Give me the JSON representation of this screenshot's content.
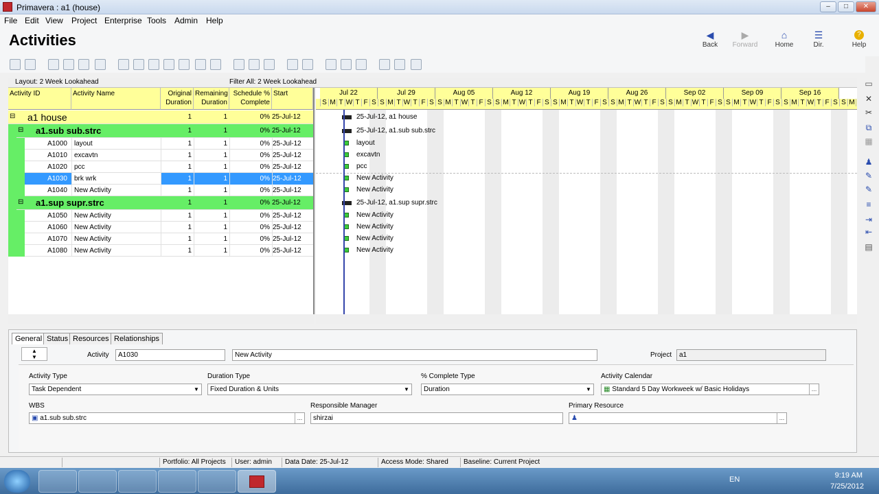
{
  "window": {
    "title": "Primavera : a1 (house)",
    "min": "–",
    "max": "□",
    "close": "✕"
  },
  "menu": [
    "File",
    "Edit",
    "View",
    "Project",
    "Enterprise",
    "Tools",
    "Admin",
    "Help"
  ],
  "header": {
    "title": "Activities",
    "nav": [
      {
        "label": "Back",
        "icon": "◀"
      },
      {
        "label": "Forward",
        "icon": "▶"
      },
      {
        "label": "Home",
        "icon": "⌂"
      },
      {
        "label": "Dir.",
        "icon": "☰"
      },
      {
        "label": "Help",
        "icon": "?"
      }
    ]
  },
  "panel": {
    "layout": "Layout: 2 Week Lookahead",
    "filter": "Filter All: 2 Week Lookahead"
  },
  "columns": {
    "id": "Activity ID",
    "name": "Activity Name",
    "orig": "Original Duration",
    "rem": "Remaining Duration",
    "pct": "Schedule % Complete",
    "start": "Start"
  },
  "rows": [
    {
      "type": "project",
      "id": "a1  house",
      "name": "",
      "orig": "1",
      "rem": "1",
      "pct": "0%",
      "start": "25-Jul-12",
      "bar": "25-Jul-12, a1  house"
    },
    {
      "type": "wbs",
      "id": "a1.sub  sub.strc",
      "name": "",
      "orig": "1",
      "rem": "1",
      "pct": "0%",
      "start": "25-Jul-12",
      "bar": "25-Jul-12, a1.sub  sub.strc"
    },
    {
      "type": "act",
      "id": "A1000",
      "name": "layout",
      "orig": "1",
      "rem": "1",
      "pct": "0%",
      "start": "25-Jul-12",
      "bar": "layout"
    },
    {
      "type": "act",
      "id": "A1010",
      "name": "excavtn",
      "orig": "1",
      "rem": "1",
      "pct": "0%",
      "start": "25-Jul-12",
      "bar": "excavtn"
    },
    {
      "type": "act",
      "id": "A1020",
      "name": "pcc",
      "orig": "1",
      "rem": "1",
      "pct": "0%",
      "start": "25-Jul-12",
      "bar": "pcc"
    },
    {
      "type": "sel",
      "id": "A1030",
      "name": "brk wrk",
      "orig": "1",
      "rem": "1",
      "pct": "0%",
      "start": "25-Jul-12",
      "bar": "New Activity"
    },
    {
      "type": "act",
      "id": "A1040",
      "name": "New Activity",
      "orig": "1",
      "rem": "1",
      "pct": "0%",
      "start": "25-Jul-12",
      "bar": "New Activity"
    },
    {
      "type": "wbs",
      "id": "a1.sup  supr.strc",
      "name": "",
      "orig": "1",
      "rem": "1",
      "pct": "0%",
      "start": "25-Jul-12",
      "bar": "25-Jul-12, a1.sup  supr.strc"
    },
    {
      "type": "act",
      "id": "A1050",
      "name": "New Activity",
      "orig": "1",
      "rem": "1",
      "pct": "0%",
      "start": "25-Jul-12",
      "bar": "New Activity"
    },
    {
      "type": "act",
      "id": "A1060",
      "name": "New Activity",
      "orig": "1",
      "rem": "1",
      "pct": "0%",
      "start": "25-Jul-12",
      "bar": "New Activity"
    },
    {
      "type": "act",
      "id": "A1070",
      "name": "New Activity",
      "orig": "1",
      "rem": "1",
      "pct": "0%",
      "start": "25-Jul-12",
      "bar": "New Activity"
    },
    {
      "type": "act",
      "id": "A1080",
      "name": "New Activity",
      "orig": "1",
      "rem": "1",
      "pct": "0%",
      "start": "25-Jul-12",
      "bar": "New Activity"
    }
  ],
  "gantt": {
    "weeks": [
      "Jul 22",
      "Jul 29",
      "Aug 05",
      "Aug 12",
      "Aug 19",
      "Aug 26",
      "Sep 02",
      "Sep 09",
      "Sep 16"
    ],
    "days": "SMTWTFS"
  },
  "details": {
    "tabs": [
      "General",
      "Status",
      "Resources",
      "Relationships"
    ],
    "activity_label": "Activity",
    "activity_id": "A1030",
    "activity_name": "New Activity",
    "project_label": "Project",
    "project": "a1",
    "activity_type_label": "Activity Type",
    "activity_type": "Task Dependent",
    "duration_type_label": "Duration Type",
    "duration_type": "Fixed Duration & Units",
    "pct_type_label": "% Complete Type",
    "pct_type": "Duration",
    "calendar_label": "Activity Calendar",
    "calendar": "Standard 5 Day Workweek w/ Basic Holidays",
    "wbs_label": "WBS",
    "wbs": "a1.sub  sub.strc",
    "manager_label": "Responsible Manager",
    "manager": "shirzai",
    "resource_label": "Primary Resource",
    "resource": ""
  },
  "status": {
    "portfolio": "Portfolio: All Projects",
    "user": "User: admin",
    "data_date": "Data Date: 25-Jul-12",
    "access": "Access Mode: Shared",
    "baseline": "Baseline: Current Project"
  },
  "tray": {
    "lang": "EN",
    "time": "9:19 AM",
    "date": "7/25/2012"
  },
  "colors": {
    "wbs": "#66ee66",
    "project": "#ffff99",
    "selected": "#3399ff",
    "bar": "#3ccb3c"
  }
}
